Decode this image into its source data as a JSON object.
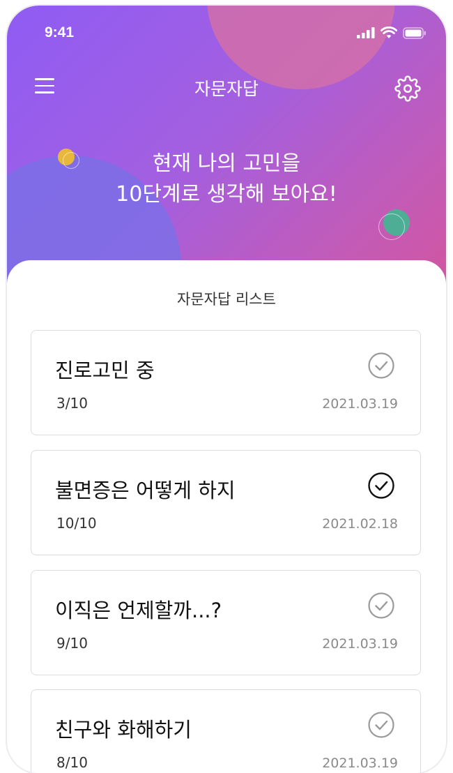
{
  "status_bar": {
    "time": "9:41",
    "icons": [
      "cellular-signal-icon",
      "wifi-icon",
      "battery-icon"
    ]
  },
  "header": {
    "title": "자문자답",
    "menu_icon": "hamburger-menu-icon",
    "settings_icon": "gear-icon",
    "hero_line1": "현재 나의 고민을",
    "hero_line2": "10단계로 생각해 보아요!"
  },
  "list": {
    "title": "자문자답 리스트",
    "items": [
      {
        "title": "진로고민 중",
        "progress": "3/10",
        "date": "2021.03.19",
        "completed": false
      },
      {
        "title": "불면증은 어떻게 하지",
        "progress": "10/10",
        "date": "2021.02.18",
        "completed": true
      },
      {
        "title": "이직은 언제할까...?",
        "progress": "9/10",
        "date": "2021.03.19",
        "completed": false
      },
      {
        "title": "친구와 화해하기",
        "progress": "8/10",
        "date": "2021.03.19",
        "completed": false
      }
    ]
  },
  "colors": {
    "gradient_start": "#8f5cf4",
    "gradient_end": "#d2559f",
    "check_complete": "#111111",
    "check_incomplete": "#9a9a9a"
  }
}
